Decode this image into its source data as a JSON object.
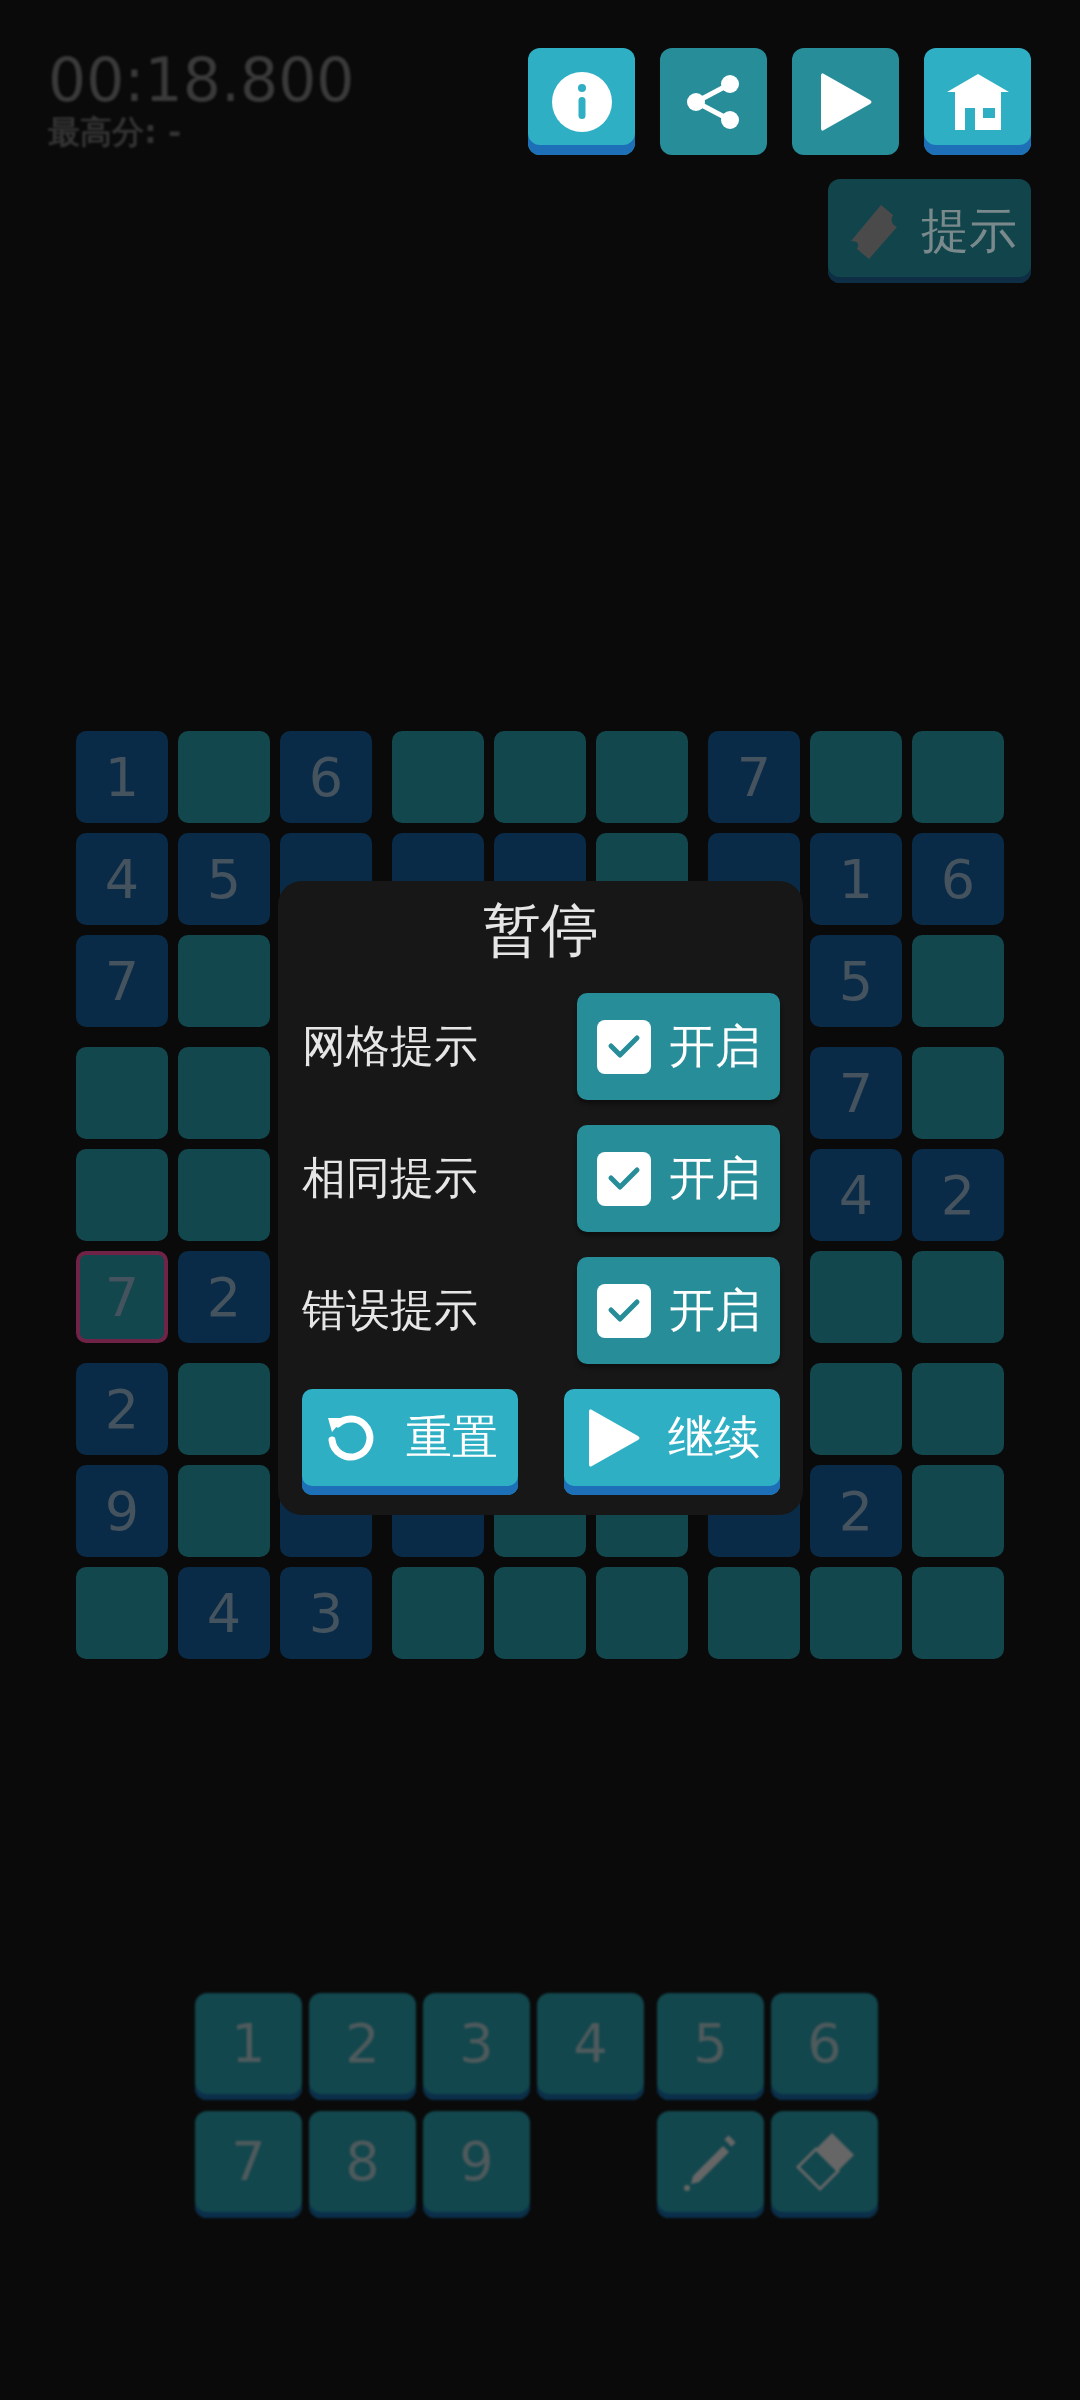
{
  "timer": {
    "time": "00:18.800",
    "best": "最高分: -"
  },
  "toolbar": [
    {
      "kind": "info",
      "raised": true
    },
    {
      "kind": "share",
      "raised": false
    },
    {
      "kind": "play",
      "raised": false
    },
    {
      "kind": "home",
      "raised": true
    }
  ],
  "hint_button": {
    "label": "提示"
  },
  "board": {
    "rows": [
      [
        {
          "kind": "given",
          "value": "1",
          "selected": false
        },
        {
          "kind": "empty",
          "selected": false
        },
        {
          "kind": "given",
          "value": "6",
          "selected": false
        },
        {
          "kind": "empty",
          "selected": false
        },
        {
          "kind": "empty",
          "selected": false
        },
        {
          "kind": "empty",
          "selected": false
        },
        {
          "kind": "given",
          "value": "7",
          "selected": false
        },
        {
          "kind": "empty",
          "selected": false
        },
        {
          "kind": "empty",
          "selected": false
        }
      ],
      [
        {
          "kind": "given",
          "value": "4",
          "selected": false
        },
        {
          "kind": "given",
          "value": "5",
          "selected": false
        },
        {
          "kind": "given",
          "selected": false
        },
        {
          "kind": "given",
          "selected": false
        },
        {
          "kind": "given",
          "selected": false
        },
        {
          "kind": "empty",
          "selected": false
        },
        {
          "kind": "given",
          "selected": false
        },
        {
          "kind": "given",
          "value": "1",
          "selected": false
        },
        {
          "kind": "given",
          "value": "6",
          "selected": false
        }
      ],
      [
        {
          "kind": "given",
          "value": "7",
          "selected": false
        },
        {
          "kind": "empty",
          "selected": false
        },
        {
          "kind": "hidden"
        },
        {
          "kind": "hidden"
        },
        {
          "kind": "hidden"
        },
        {
          "kind": "hidden"
        },
        {
          "kind": "hidden"
        },
        {
          "kind": "given",
          "value": "5",
          "selected": false
        },
        {
          "kind": "empty",
          "selected": false
        }
      ],
      [
        {
          "kind": "empty",
          "selected": false
        },
        {
          "kind": "empty",
          "selected": false
        },
        {
          "kind": "hidden"
        },
        {
          "kind": "hidden"
        },
        {
          "kind": "hidden"
        },
        {
          "kind": "hidden"
        },
        {
          "kind": "hidden"
        },
        {
          "kind": "given",
          "value": "7",
          "selected": false
        },
        {
          "kind": "empty",
          "selected": false
        }
      ],
      [
        {
          "kind": "empty",
          "selected": false
        },
        {
          "kind": "empty",
          "selected": false
        },
        {
          "kind": "hidden"
        },
        {
          "kind": "hidden"
        },
        {
          "kind": "hidden"
        },
        {
          "kind": "hidden"
        },
        {
          "kind": "hidden"
        },
        {
          "kind": "given",
          "value": "4",
          "selected": false
        },
        {
          "kind": "given",
          "value": "2",
          "selected": false
        }
      ],
      [
        {
          "kind": "entered",
          "value": "7",
          "selected": true
        },
        {
          "kind": "given",
          "value": "2",
          "selected": false
        },
        {
          "kind": "hidden"
        },
        {
          "kind": "hidden"
        },
        {
          "kind": "hidden"
        },
        {
          "kind": "hidden"
        },
        {
          "kind": "hidden"
        },
        {
          "kind": "empty",
          "selected": false
        },
        {
          "kind": "empty",
          "selected": false
        }
      ],
      [
        {
          "kind": "given",
          "value": "2",
          "selected": false
        },
        {
          "kind": "empty",
          "selected": false
        },
        {
          "kind": "hidden"
        },
        {
          "kind": "hidden"
        },
        {
          "kind": "hidden"
        },
        {
          "kind": "hidden"
        },
        {
          "kind": "hidden"
        },
        {
          "kind": "empty",
          "selected": false
        },
        {
          "kind": "empty",
          "selected": false
        }
      ],
      [
        {
          "kind": "given",
          "value": "9",
          "selected": false
        },
        {
          "kind": "empty",
          "selected": false
        },
        {
          "kind": "given",
          "selected": false
        },
        {
          "kind": "given",
          "selected": false
        },
        {
          "kind": "empty",
          "selected": false
        },
        {
          "kind": "empty",
          "selected": false
        },
        {
          "kind": "given",
          "selected": false
        },
        {
          "kind": "given",
          "value": "2",
          "selected": false
        },
        {
          "kind": "empty",
          "selected": false
        }
      ],
      [
        {
          "kind": "empty",
          "selected": false
        },
        {
          "kind": "given",
          "value": "4",
          "selected": false
        },
        {
          "kind": "given",
          "value": "3",
          "selected": false
        },
        {
          "kind": "empty",
          "selected": false
        },
        {
          "kind": "empty",
          "selected": false
        },
        {
          "kind": "empty",
          "selected": false
        },
        {
          "kind": "empty",
          "selected": false
        },
        {
          "kind": "empty",
          "selected": false
        },
        {
          "kind": "empty",
          "selected": false
        }
      ]
    ]
  },
  "pause_dialog": {
    "title": "暂停",
    "options": [
      {
        "label": "网格提示",
        "toggle": "开启",
        "checked": true
      },
      {
        "label": "相同提示",
        "toggle": "开启",
        "checked": true
      },
      {
        "label": "错误提示",
        "toggle": "开启",
        "checked": true
      }
    ],
    "buttons": [
      {
        "kind": "reset",
        "label": "重置"
      },
      {
        "kind": "continue",
        "label": "继续"
      }
    ]
  },
  "numpad": {
    "keys": [
      {
        "kind": "digit",
        "label": "1"
      },
      {
        "kind": "digit",
        "label": "2"
      },
      {
        "kind": "digit",
        "label": "3"
      },
      {
        "kind": "digit",
        "label": "4"
      },
      {
        "kind": "digit",
        "label": "5"
      },
      {
        "kind": "digit",
        "label": "6"
      },
      {
        "kind": "digit",
        "label": "7"
      },
      {
        "kind": "digit",
        "label": "8"
      },
      {
        "kind": "digit",
        "label": "9"
      },
      {
        "kind": "spacer"
      },
      {
        "kind": "pencil"
      },
      {
        "kind": "eraser"
      }
    ]
  }
}
